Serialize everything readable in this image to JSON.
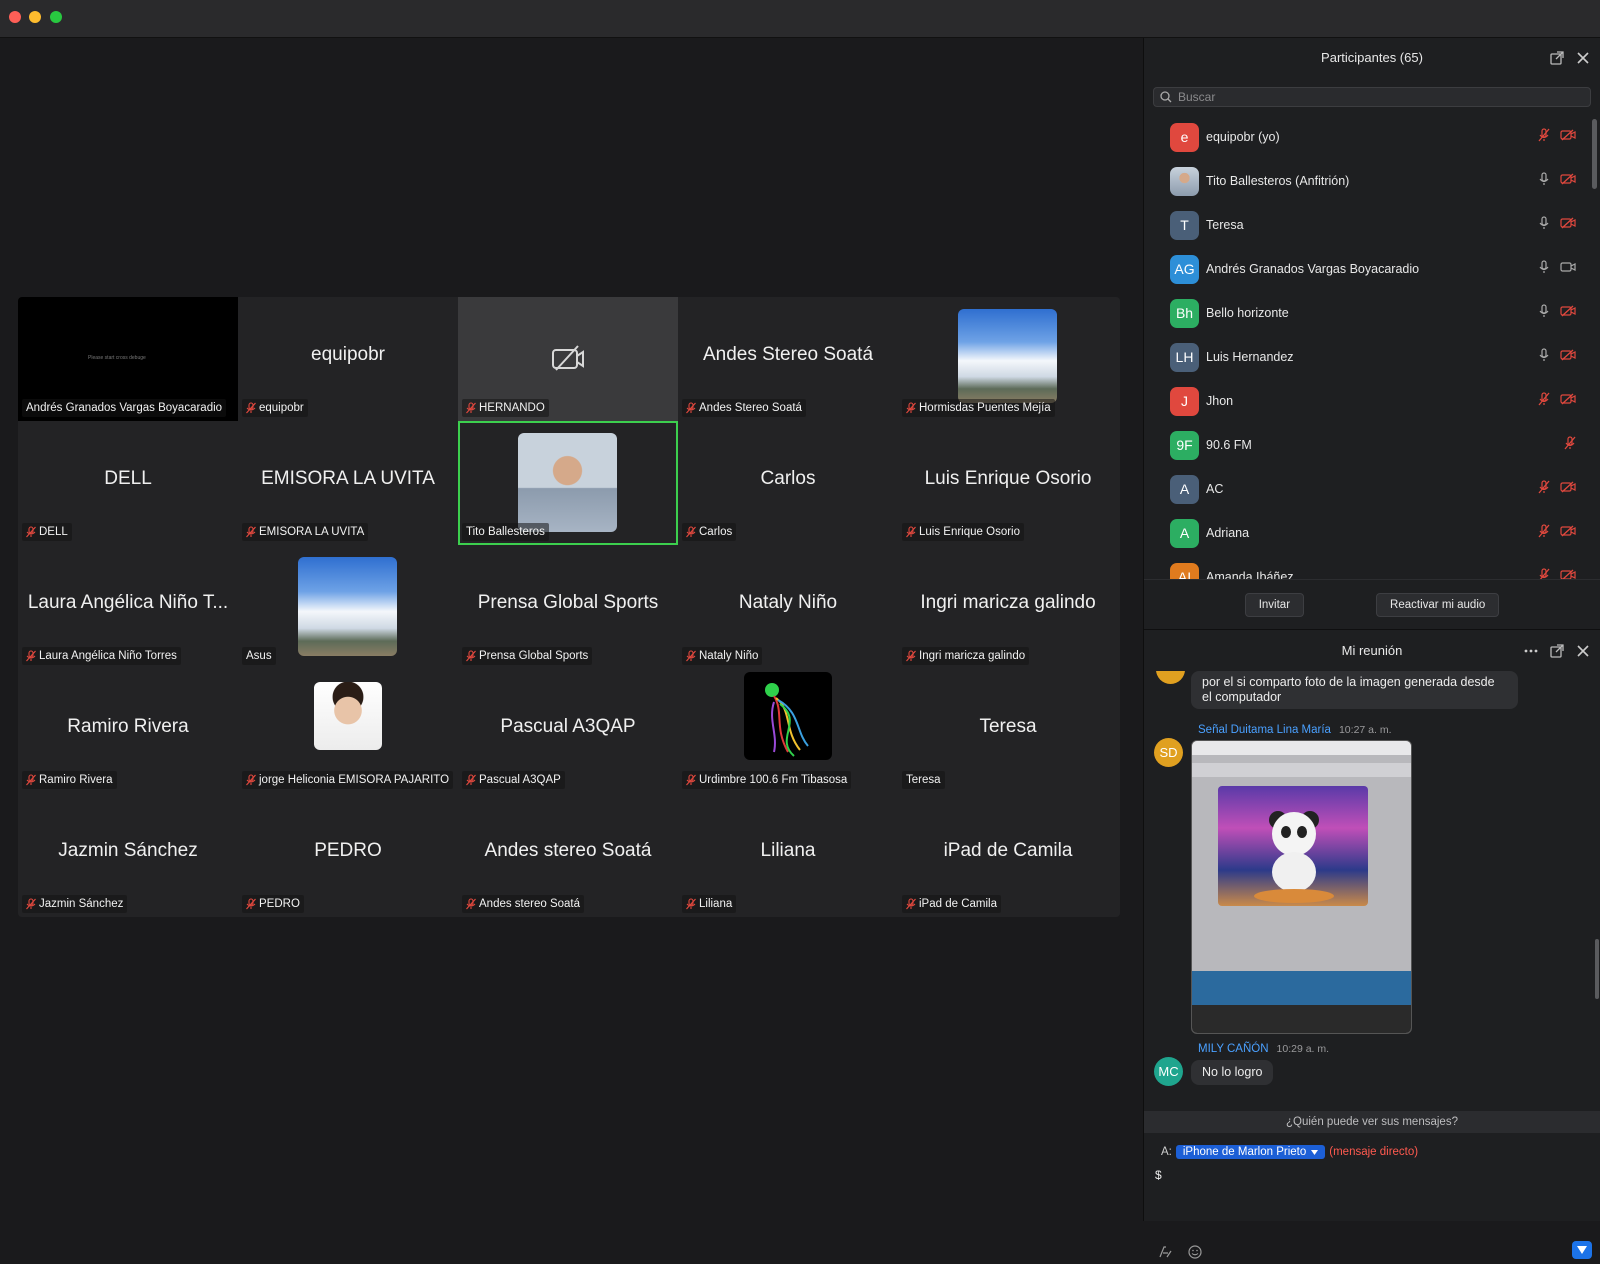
{
  "grid": {
    "tiles": [
      {
        "big": "",
        "label": "Andrés Granados Vargas Boyacaradio",
        "muted": false,
        "tiny": "Please start cross debuge"
      },
      {
        "big": "equipobr",
        "label": "equipobr",
        "muted": true
      },
      {
        "big": "",
        "label": "HERNANDO",
        "muted": true
      },
      {
        "big": "Andes Stereo Soatá",
        "label": "Andes Stereo Soatá",
        "muted": true
      },
      {
        "big": "",
        "label": "Hormisdas Puentes Mejía",
        "muted": true
      },
      {
        "big": "DELL",
        "label": "DELL",
        "muted": true
      },
      {
        "big": "EMISORA LA UVITA",
        "label": "EMISORA LA UVITA",
        "muted": true
      },
      {
        "big": "",
        "label": "Tito Ballesteros",
        "muted": false
      },
      {
        "big": "Carlos",
        "label": "Carlos",
        "muted": true
      },
      {
        "big": "Luis Enrique Osorio",
        "label": "Luis Enrique Osorio",
        "muted": true
      },
      {
        "big": "Laura Angélica Niño T...",
        "label": "Laura Angélica Niño Torres",
        "muted": true
      },
      {
        "big": "",
        "label": "Asus",
        "muted": false
      },
      {
        "big": "Prensa Global Sports",
        "label": "Prensa Global Sports",
        "muted": true
      },
      {
        "big": "Nataly Niño",
        "label": "Nataly Niño",
        "muted": true
      },
      {
        "big": "Ingri maricza galindo",
        "label": "Ingri maricza galindo",
        "muted": true
      },
      {
        "big": "Ramiro Rivera",
        "label": "Ramiro Rivera",
        "muted": true
      },
      {
        "big": "",
        "label": "jorge Heliconia EMISORA PAJARITO",
        "muted": true
      },
      {
        "big": "Pascual A3QAP",
        "label": "Pascual A3QAP",
        "muted": true
      },
      {
        "big": "",
        "label": "Urdimbre 100.6 Fm Tibasosa",
        "muted": true
      },
      {
        "big": "Teresa",
        "label": "Teresa",
        "muted": false
      },
      {
        "big": "Jazmin Sánchez",
        "label": "Jazmin Sánchez",
        "muted": true
      },
      {
        "big": "PEDRO",
        "label": "PEDRO",
        "muted": true
      },
      {
        "big": "Andes stereo Soatá",
        "label": "Andes stereo Soatá",
        "muted": true
      },
      {
        "big": "Liliana",
        "label": "Liliana",
        "muted": true
      },
      {
        "big": "iPad de Camila",
        "label": "iPad de Camila",
        "muted": true
      }
    ]
  },
  "participants": {
    "title": "Participantes (65)",
    "search_placeholder": "Buscar",
    "items": [
      {
        "initials": "e",
        "name": "equipobr (yo)",
        "color": "#e0483e",
        "mic": "off",
        "cam": "off"
      },
      {
        "initials": "",
        "name": "Tito Ballesteros (Anfitrión)",
        "color": "#8a96a6",
        "mic": "on",
        "cam": "off"
      },
      {
        "initials": "T",
        "name": "Teresa",
        "color": "#4a5f78",
        "mic": "on",
        "cam": "off"
      },
      {
        "initials": "AG",
        "name": "Andrés Granados Vargas Boyacaradio",
        "color": "#2d8fd8",
        "mic": "on",
        "cam": "on"
      },
      {
        "initials": "Bh",
        "name": "Bello horizonte",
        "color": "#2cae62",
        "mic": "on",
        "cam": "off"
      },
      {
        "initials": "LH",
        "name": "Luis Hernandez",
        "color": "#4a5f78",
        "mic": "on",
        "cam": "off"
      },
      {
        "initials": "J",
        "name": "Jhon",
        "color": "#e0483e",
        "mic": "off",
        "cam": "off"
      },
      {
        "initials": "9F",
        "name": "90.6 FM",
        "color": "#2cae62",
        "mic": "off",
        "cam": "none"
      },
      {
        "initials": "A",
        "name": "AC",
        "color": "#4a5f78",
        "mic": "off",
        "cam": "off"
      },
      {
        "initials": "A",
        "name": "Adriana",
        "color": "#2cae62",
        "mic": "off",
        "cam": "off"
      },
      {
        "initials": "AI",
        "name": "Amanda Ibáñez",
        "color": "#e07b1e",
        "mic": "off",
        "cam": "off"
      }
    ],
    "invite_label": "Invitar",
    "unmute_label": "Reactivar mi audio"
  },
  "chat": {
    "title": "Mi reunión",
    "prev_message": "por el si comparto foto de la imagen generada desde el computador",
    "messages": [
      {
        "initials": "SD",
        "sender": "Señal Duitama Lina María",
        "time": "10:27 a. m.",
        "color": "#e0a020"
      },
      {
        "initials": "MC",
        "sender": "MILY CAÑÓN",
        "time": "10:29 a. m.",
        "color": "#1fa58e",
        "text": "No lo logro"
      }
    ],
    "who_can_see": "¿Quién puede ver sus mensajes?",
    "to_label": "A:",
    "recipient": "iPhone de Marlon Prieto",
    "direct_note": "(mensaje directo)",
    "draft": "$"
  }
}
